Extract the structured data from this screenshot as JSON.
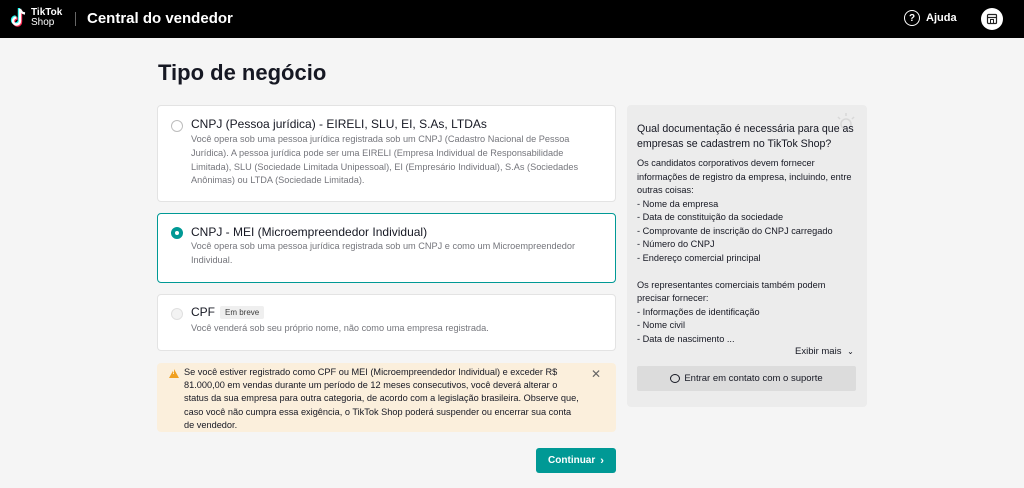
{
  "header": {
    "logo_line1": "TikTok",
    "logo_line2": "Shop",
    "app_title": "Central do vendedor",
    "help_label": "Ajuda",
    "help_icon": "question-circle-icon",
    "store_icon": "store-icon"
  },
  "page": {
    "title": "Tipo de negócio"
  },
  "options": [
    {
      "title": "CNPJ (Pessoa jurídica) - EIRELI, SLU, EI, S.As, LTDAs",
      "description": "Você opera sob uma pessoa jurídica registrada sob um CNPJ (Cadastro Nacional de Pessoa Jurídica). A pessoa jurídica pode ser uma EIRELI (Empresa Individual de Responsabilidade Limitada), SLU (Sociedade Limitada Unipessoal), EI (Empresário Individual), S.As (Sociedades Anônimas) ou LTDA (Sociedade Limitada)."
    },
    {
      "title": "CNPJ - MEI (Microempreendedor Individual)",
      "description": "Você opera sob uma pessoa jurídica registrada sob um CNPJ e como um Microempreendedor Individual."
    },
    {
      "title": "CPF",
      "badge": "Em breve",
      "description": "Você venderá sob seu próprio nome, não como uma empresa registrada."
    }
  ],
  "warning": {
    "text": "Se você estiver registrado como CPF ou MEI (Microempreendedor Individual) e exceder R$ 81.000,00 em vendas durante um período de 12 meses consecutivos, você deverá alterar o status da sua empresa para outra categoria, de acordo com a legislação brasileira. Observe que, caso você não cumpra essa exigência, o TikTok Shop poderá suspender ou encerrar sua conta de vendedor.",
    "close_symbol": "✕"
  },
  "continue_label": "Continuar",
  "sidebar": {
    "title": "Qual documentação é necessária para que as empresas se cadastrem no TikTok Shop?",
    "intro": "Os candidatos corporativos devem fornecer informações de registro da empresa, incluindo, entre outras coisas:",
    "company_items": [
      "- Nome da empresa",
      "- Data de constituição da sociedade",
      "- Comprovante de inscrição do CNPJ carregado",
      "- Número do CNPJ",
      "- Endereço comercial principal"
    ],
    "reps_intro": "Os representantes comerciais também podem precisar fornecer:",
    "rep_items": [
      "- Informações de identificação",
      "- Nome civil",
      "- Data de nascimento ..."
    ],
    "more_label": "Exibir mais",
    "support_label": "Entrar em contato com o suporte"
  },
  "colors": {
    "accent": "#009995",
    "warning_bg": "#fbefdc",
    "header_bg": "#000000"
  }
}
